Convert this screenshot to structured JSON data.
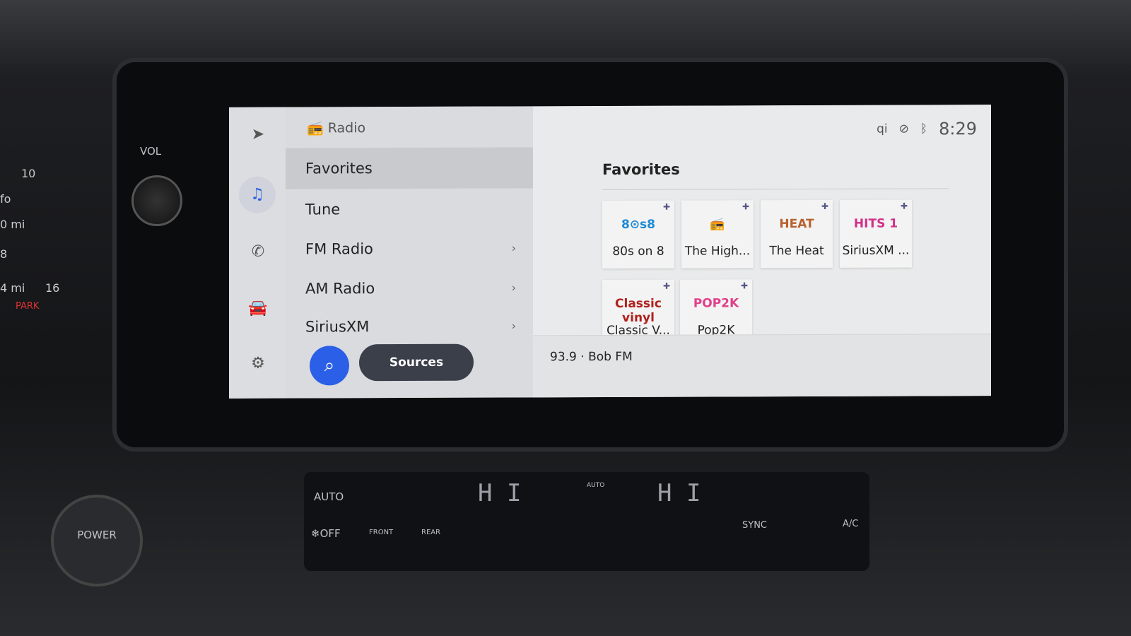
{
  "hardware": {
    "vol_label": "VOL",
    "power_label": "POWER",
    "cluster": [
      "10",
      "fo",
      "0 mi",
      "8",
      "4 mi",
      "16",
      "PARK"
    ]
  },
  "rail": [
    {
      "icon": "navigation-arrow-icon"
    },
    {
      "icon": "music-note-icon",
      "active": true
    },
    {
      "icon": "phone-icon"
    },
    {
      "icon": "car-icon"
    },
    {
      "icon": "gear-icon"
    }
  ],
  "menu": {
    "header": "Radio",
    "header_icon": "radio-icon",
    "items": [
      {
        "label": "Favorites",
        "selected": true
      },
      {
        "label": "Tune"
      },
      {
        "label": "FM Radio",
        "chevron": true
      },
      {
        "label": "AM Radio",
        "chevron": true
      },
      {
        "label": "SiriusXM",
        "chevron": true
      }
    ],
    "search_icon": "search-icon",
    "sources_label": "Sources"
  },
  "status": {
    "icons": [
      "wireless-charging-icon",
      "voice-muted-icon",
      "bluetooth-icon"
    ],
    "time": "8:29"
  },
  "favorites": {
    "title": "Favorites",
    "tiles": [
      {
        "name": "80s on 8",
        "logo": "8⊙s8",
        "color": "#1e8ad6"
      },
      {
        "name": "The High...",
        "logo": "📻",
        "color": "#888888"
      },
      {
        "name": "The Heat",
        "logo": "HEAT",
        "color": "#b8622e"
      },
      {
        "name": "SiriusXM ...",
        "logo": "HITS 1",
        "color": "#d0308a"
      },
      {
        "name": "Classic V...",
        "logo": "Classic vinyl",
        "color": "#b0201c"
      },
      {
        "name": "Pop2K",
        "logo": "POP2K",
        "color": "#e0408a"
      }
    ]
  },
  "now_playing": "93.9 · Bob FM",
  "climate": {
    "auto": "AUTO",
    "off": "❄OFF",
    "front": "FRONT",
    "rear": "REAR",
    "sync": "SYNC",
    "ac": "A/C",
    "left_temp": "H I",
    "right_temp": "H I",
    "fan_auto": "AUTO"
  }
}
